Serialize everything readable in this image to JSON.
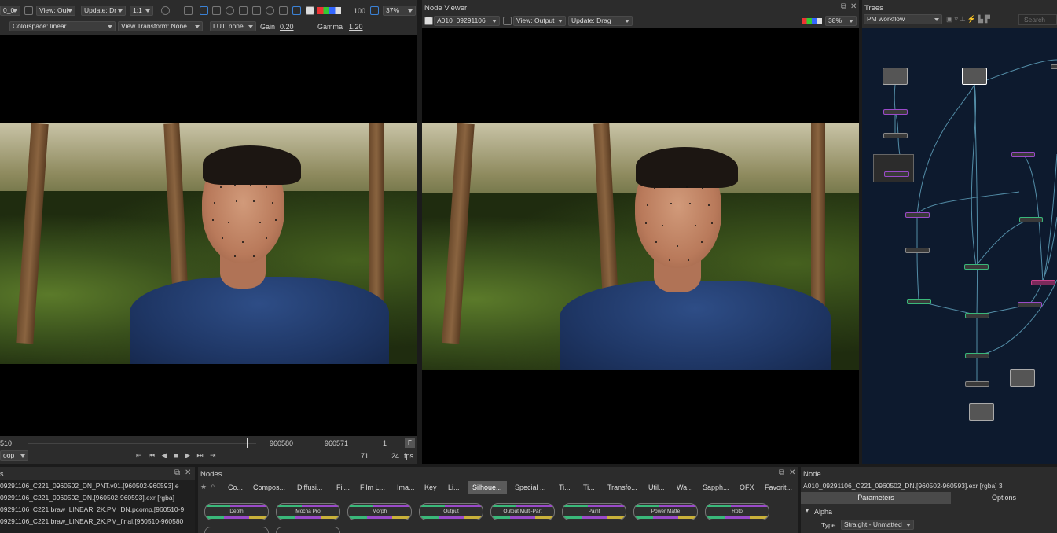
{
  "left_viewer": {
    "toolbar1": {
      "frame_dd": "0_0",
      "view_dd": "View: Oui",
      "update_dd": "Update: Dr",
      "ratio_dd": "1:1",
      "zoom_value": "100",
      "zoom_dd": "37%"
    },
    "toolbar2": {
      "colorspace_dd": "Colorspace: linear",
      "view_transform_dd": "View Transform: None",
      "lut_dd": "LUT: none",
      "gain_label": "Gain",
      "gain_value": "0.20",
      "gamma_label": "Gamma",
      "gamma_value": "1.20"
    },
    "timeline": {
      "start_frame": "510",
      "current_frame": "960580",
      "end_frame": "960571",
      "step": "1",
      "f_button": "F",
      "loop_dd": "oop",
      "frame_field": "71",
      "fps_value": "24",
      "fps_label": "fps"
    }
  },
  "node_viewer": {
    "title": "Node Viewer",
    "clip_dd": "A010_09291106_",
    "view_dd": "View: Output",
    "update_dd": "Update: Drag",
    "zoom_dd": "38%"
  },
  "trees": {
    "title": "Trees",
    "workflow_dd": "PM workflow",
    "search_placeholder": "Search"
  },
  "files_panel": {
    "title": "s",
    "files": [
      "09291106_C221_0960502_DN_PNT.v01.[960502-960593].e",
      "09291106_C221_0960502_DN.[960502-960593].exr [rgba]",
      "09291106_C221.braw_LINEAR_2K.PM_DN.pcomp.[960510-9",
      "09291106_C221.braw_LINEAR_2K.PM_final.[960510-960580"
    ]
  },
  "nodes_panel": {
    "title": "Nodes",
    "tabs": [
      "Co...",
      "Compos...",
      "Diffusi...",
      "Fil...",
      "Film L...",
      "Ima...",
      "Key",
      "Li...",
      "Silhoue...",
      "Special ...",
      "Ti...",
      "Ti...",
      "Transfo...",
      "Util...",
      "Wa...",
      "Sapph...",
      "OFX",
      "Favorit..."
    ],
    "active_tab": 8,
    "buttons": [
      "Depth",
      "Mocha Pro",
      "Morph",
      "Output",
      "Output Multi-Part",
      "Paint",
      "Power Matte",
      "Roto"
    ]
  },
  "node_panel": {
    "title": "Node",
    "node_name": "A010_09291106_C221_0960502_DN.[960502-960593].exr [rgba] 3",
    "tab_parameters": "Parameters",
    "tab_options": "Options",
    "section_alpha": "Alpha",
    "type_label": "Type",
    "type_dd": "Straight - Unmatted"
  },
  "colors": {
    "accent_tab": "#5b5b5b",
    "graph_bg": "#0d1a2e",
    "wire": "#6bb4d0"
  }
}
